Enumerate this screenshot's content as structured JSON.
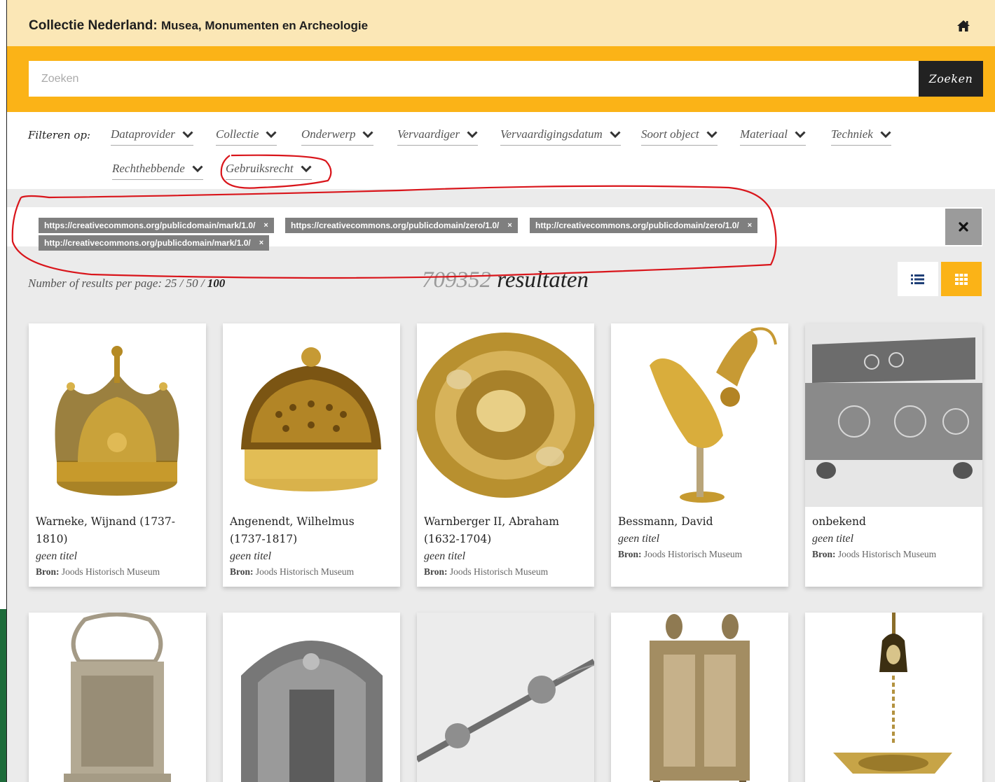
{
  "header": {
    "brand_main": "Collectie Nederland:",
    "brand_sub": "Musea, Monumenten en Archeologie",
    "home_icon": "home-icon"
  },
  "search": {
    "placeholder": "Zoeken",
    "value": "",
    "button_label": "Zoeken"
  },
  "filters": {
    "label": "Filteren op:",
    "items": [
      "Dataprovider",
      "Collectie",
      "Onderwerp",
      "Vervaardiger",
      "Vervaardigingsdatum",
      "Soort object",
      "Materiaal",
      "Techniek",
      "Rechthebbende",
      "Gebruiksrecht"
    ]
  },
  "active_filters": {
    "tags": [
      "https://creativecommons.org/publicdomain/mark/1.0/",
      "https://creativecommons.org/publicdomain/zero/1.0/",
      "http://creativecommons.org/publicdomain/zero/1.0/",
      "http://creativecommons.org/publicdomain/mark/1.0/"
    ],
    "remove_glyph": "×",
    "clear_icon": "close-icon"
  },
  "results": {
    "per_page_label": "Number of results per page:",
    "per_page_options": [
      "25",
      "50",
      "100"
    ],
    "per_page_separator": "/",
    "per_page_selected": "100",
    "count": "709352",
    "count_label": "resultaten",
    "view_modes": [
      "list",
      "grid"
    ],
    "active_view": "grid"
  },
  "cards": [
    {
      "maker": "Warneke, Wijnand (1737-1810)",
      "title": "geen titel",
      "source_label": "Bron:",
      "source": "Joods Historisch Museum"
    },
    {
      "maker": "Angenendt, Wilhelmus (1737-1817)",
      "title": "geen titel",
      "source_label": "Bron:",
      "source": "Joods Historisch Museum"
    },
    {
      "maker": "Warnberger II, Abraham (1632-1704)",
      "title": "geen titel",
      "source_label": "Bron:",
      "source": "Joods Historisch Museum"
    },
    {
      "maker": "Bessmann, David",
      "title": "geen titel",
      "source_label": "Bron:",
      "source": "Joods Historisch Museum"
    },
    {
      "maker": "onbekend",
      "title": "geen titel",
      "source_label": "Bron:",
      "source": "Joods Historisch Museum"
    }
  ],
  "colors": {
    "header_bg": "#fbe7b6",
    "accent": "#fbb317",
    "dark": "#222222",
    "tag_bg": "#7f7f7f",
    "annotation": "#d9151b"
  }
}
